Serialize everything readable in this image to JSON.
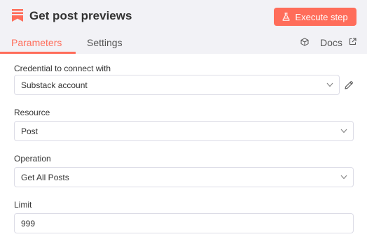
{
  "header": {
    "node_title": "Get post previews",
    "execute_label": "Execute step",
    "accent_color": "#ff6d5a",
    "node_icon": "substack-logo-icon"
  },
  "tabs": [
    {
      "label": "Parameters",
      "active": true
    },
    {
      "label": "Settings",
      "active": false
    }
  ],
  "docs": {
    "label": "Docs",
    "icon": "external-link-icon"
  },
  "fields": {
    "credential": {
      "label": "Credential to connect with",
      "value": "Substack account"
    },
    "resource": {
      "label": "Resource",
      "value": "Post"
    },
    "operation": {
      "label": "Operation",
      "value": "Get All Posts"
    },
    "limit": {
      "label": "Limit",
      "value": "999"
    }
  }
}
